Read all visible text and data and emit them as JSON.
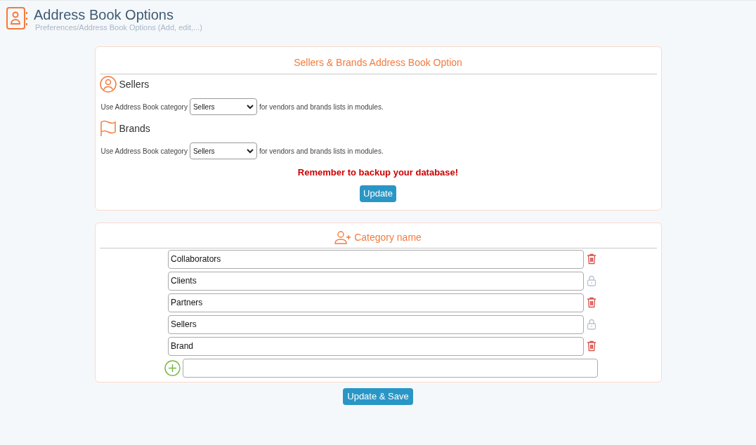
{
  "header": {
    "title": "Address Book Options",
    "breadcrumb": "Preferences/Address Book Options (Add, edit,...)"
  },
  "options_panel": {
    "title": "Sellers & Brands Address Book Option",
    "sections": [
      {
        "kind": "person",
        "heading": "Sellers",
        "prefix": "Use Address Book category",
        "value": "Sellers",
        "suffix": "for vendors and brands lists in modules."
      },
      {
        "kind": "flag",
        "heading": "Brands",
        "prefix": "Use Address Book category",
        "value": "Sellers",
        "suffix": "for vendors and brands lists in modules."
      }
    ],
    "warning": "Remember to backup your database!",
    "button": "Update"
  },
  "category_panel": {
    "title": "Category name",
    "categories": [
      {
        "value": "Collaborators",
        "locked": false
      },
      {
        "value": "Clients",
        "locked": true
      },
      {
        "value": "Partners",
        "locked": false
      },
      {
        "value": "Sellers",
        "locked": true
      },
      {
        "value": "Brand",
        "locked": false
      }
    ]
  },
  "save_button": "Update & Save"
}
